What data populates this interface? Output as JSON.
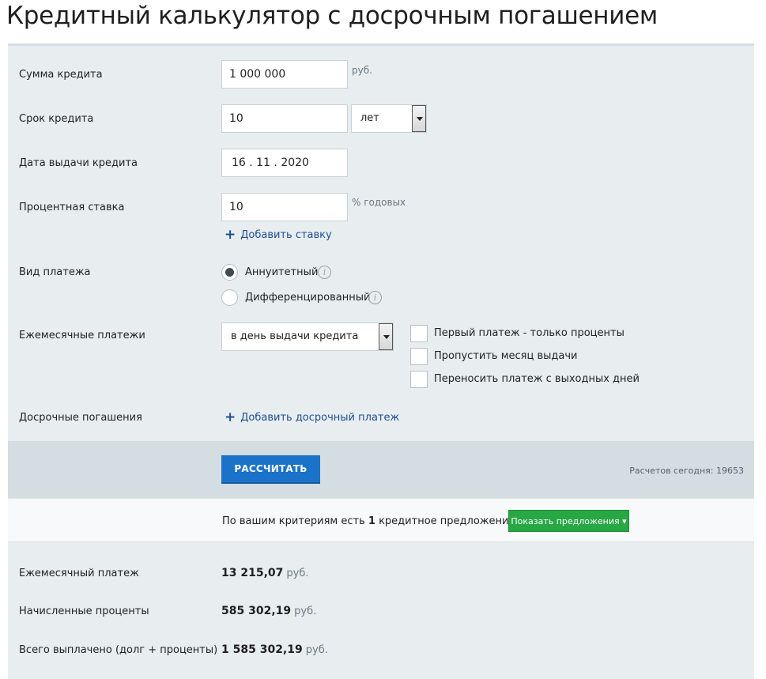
{
  "page": {
    "title": "Кредитный калькулятор с досрочным погашением"
  },
  "form": {
    "amount": {
      "label": "Сумма кредита",
      "value": "1 000 000",
      "unit": "руб."
    },
    "term": {
      "label": "Срок кредита",
      "value": "10",
      "unit_selected": "лет"
    },
    "issue_date": {
      "label": "Дата выдачи кредита",
      "value": "16 . 11 . 2020"
    },
    "rate": {
      "label": "Процентная ставка",
      "value": "10",
      "unit": "% годовых",
      "add_link": "Добавить ставку"
    },
    "payment_type": {
      "label": "Вид платежа",
      "options": [
        "Аннуитетный",
        "Дифференцированный"
      ],
      "selected": "Аннуитетный"
    },
    "monthly": {
      "label": "Ежемесячные платежи",
      "selected": "в день выдачи кредита",
      "checkboxes": [
        "Первый платеж - только проценты",
        "Пропустить месяц выдачи",
        "Переносить платеж с выходных дней"
      ]
    },
    "early": {
      "label": "Досрочные погашения",
      "add_link": "Добавить досрочный платеж"
    }
  },
  "actions": {
    "calculate_label": "РАССЧИТАТЬ",
    "count_text": "Расчетов сегодня: 19653"
  },
  "offers": {
    "text_before": "По вашим критериям есть",
    "count": "1",
    "text_after": "кредитное предложение.",
    "button_label": "Показать предложения ▾"
  },
  "results": {
    "monthly_payment": {
      "label": "Ежемесячный платеж",
      "value": "13 215,07",
      "unit": "руб."
    },
    "interest": {
      "label": "Начисленные проценты",
      "value": "585 302,19",
      "unit": "руб."
    },
    "total": {
      "label": "Всего выплачено (долг + проценты)",
      "value": "1 585 302,19",
      "unit": "руб."
    }
  }
}
